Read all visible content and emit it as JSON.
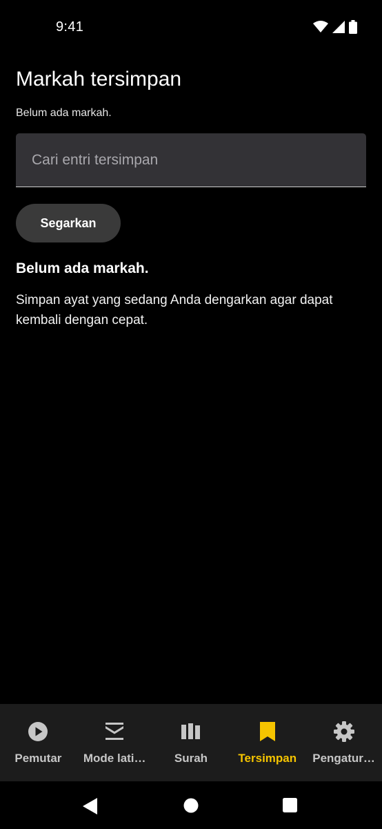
{
  "status_bar": {
    "time": "9:41",
    "icons": [
      "wifi-icon",
      "signal-icon",
      "battery-icon"
    ]
  },
  "page": {
    "title": "Markah tersimpan",
    "subtitle": "Belum ada markah."
  },
  "search": {
    "placeholder": "Cari entri tersimpan",
    "value": ""
  },
  "refresh_label": "Segarkan",
  "empty_state": {
    "heading": "Belum ada markah.",
    "body": "Simpan ayat yang sedang Anda dengarkan agar dapat kembali dengan cepat."
  },
  "bottom_nav": {
    "active_color": "#f5c400",
    "items": [
      {
        "label": "Pemutar",
        "icon": "play-circle-icon",
        "active": false
      },
      {
        "label": "Mode lati…",
        "icon": "practice-stack-icon",
        "active": false
      },
      {
        "label": "Surah",
        "icon": "books-icon",
        "active": false
      },
      {
        "label": "Tersimpan",
        "icon": "bookmark-icon",
        "active": true
      },
      {
        "label": "Pengatur…",
        "icon": "gear-icon",
        "active": false
      }
    ]
  },
  "system_nav": {
    "buttons": [
      "back-icon",
      "home-icon",
      "recents-icon"
    ]
  }
}
